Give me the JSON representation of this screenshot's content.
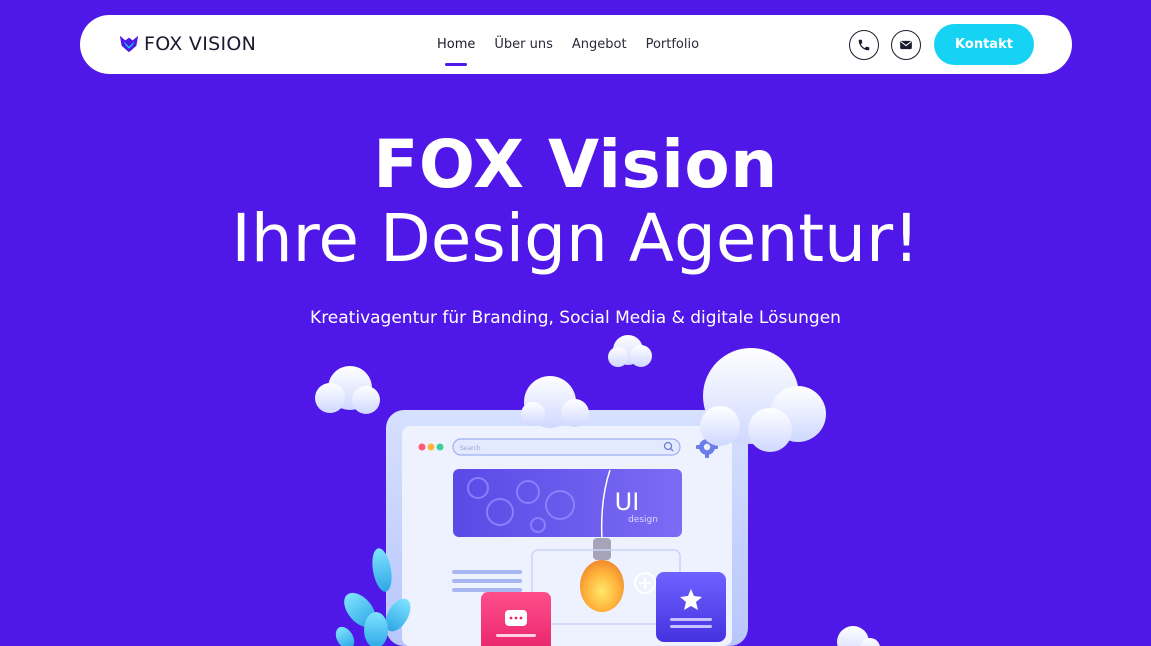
{
  "brand": {
    "name": "FOX VISION",
    "logo_icon": "fox-logo-icon"
  },
  "nav": {
    "items": [
      {
        "label": "Home",
        "active": true
      },
      {
        "label": "Über uns",
        "active": false
      },
      {
        "label": "Angebot",
        "active": false
      },
      {
        "label": "Portfolio",
        "active": false
      }
    ],
    "phone_icon": "phone-icon",
    "mail_icon": "mail-icon",
    "contact_label": "Kontakt"
  },
  "hero": {
    "title_bold": "FOX",
    "title_rest": " Vision",
    "title_line2": "Ihre Design Agentur!",
    "subtitle": "Kreativagentur für Branding, Social Media & digitale Lösungen"
  },
  "illustration": {
    "search_placeholder": "Search",
    "banner_big": "UI",
    "banner_small": "design"
  },
  "colors": {
    "background": "#5018e8",
    "accent": "#16d2f3",
    "nav_text": "#1a1a2e"
  }
}
